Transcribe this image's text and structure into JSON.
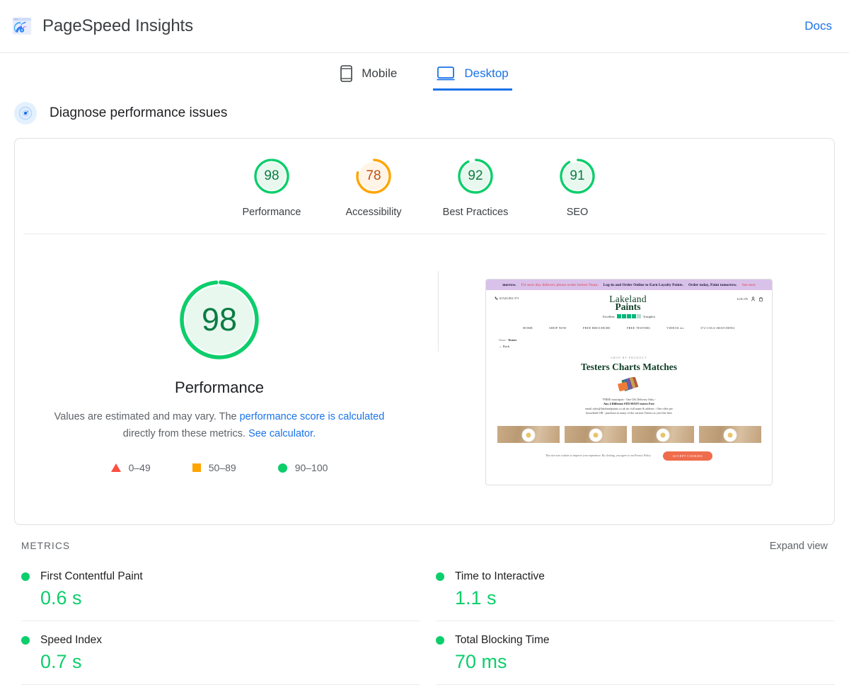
{
  "header": {
    "title": "PageSpeed Insights",
    "logo_icon": "pagespeed-logo",
    "docs_label": "Docs"
  },
  "tabs": [
    {
      "label": "Mobile",
      "icon": "mobile-icon",
      "active": false
    },
    {
      "label": "Desktop",
      "icon": "desktop-icon",
      "active": true
    }
  ],
  "diagnose": {
    "icon": "gauge-icon",
    "title": "Diagnose performance issues"
  },
  "category_scores": [
    {
      "label": "Performance",
      "score": "98",
      "color": "#0cce6b",
      "fill": "#e8f8ef",
      "text_color": "#0a7c43",
      "percent": 98
    },
    {
      "label": "Accessibility",
      "score": "78",
      "color": "#ffa400",
      "fill": "#fff4e5",
      "text_color": "#bf4f12",
      "percent": 78
    },
    {
      "label": "Best Practices",
      "score": "92",
      "color": "#0cce6b",
      "fill": "#e8f8ef",
      "text_color": "#0a7c43",
      "percent": 92
    },
    {
      "label": "SEO",
      "score": "91",
      "color": "#0cce6b",
      "fill": "#e8f8ef",
      "text_color": "#0a7c43",
      "percent": 91
    }
  ],
  "performance_detail": {
    "score": "98",
    "percent": 98,
    "color": "#0cce6b",
    "fill": "#e8f8ef",
    "text_color": "#0a7c43",
    "caption": "Performance",
    "desc_part1": "Values are estimated and may vary. The ",
    "desc_link1": "performance score is calculated",
    "desc_part2": " directly from these metrics. ",
    "desc_link2": "See calculator."
  },
  "legend": [
    {
      "shape": "triangle",
      "range": "0–49",
      "color": "#ff4e42"
    },
    {
      "shape": "square",
      "range": "50–89",
      "color": "#ffa400"
    },
    {
      "shape": "circle",
      "range": "90–100",
      "color": "#0cce6b"
    }
  ],
  "thumbnail": {
    "banner_left": "morrow.",
    "banner_pink1": "Fir next day delivery please order before Noon.",
    "banner_mid": "Log-in and Order Online to Earn Loyalty Points.",
    "banner_right": "Order today, Paint tomorrow.",
    "banner_pink2": "See next",
    "phone": "01524 852 371",
    "brand_line1": "Lakeland",
    "brand_line2": "Paints",
    "login": "LOG IN",
    "trust_label": "Excellent",
    "trust_brand": "Trustpilot",
    "nav": [
      "HOME",
      "SHOP NOW",
      "FREE BROCHURE",
      "FREE TESTERS",
      "VIDEOS etc",
      "372 COLS+MATCHING"
    ],
    "breadcrumb_home": "Home -",
    "breadcrumb_current": "Testers",
    "back": "Back",
    "kicker": "SHOP BY PRODUCT",
    "heading": "Testers Charts Matches",
    "promo_line1": "*FREE matchpots - One UK Delivery Only -",
    "promo_line2": "Any 4 Different STD MATT testers Free",
    "promo_line3": "email sales@lakelandpaints.co.uk inc full name & address - One offer per",
    "promo_line4": "household OR - purchase as many of the various Testers as you like here",
    "cookie_text": "This site uses cookies to improve your experience. By clicking, you agree to our Privacy Policy.",
    "cookie_button": "ACCEPT COOKIES"
  },
  "metrics_section": {
    "title": "METRICS",
    "expand_label": "Expand view"
  },
  "metrics": [
    {
      "name": "First Contentful Paint",
      "value": "0.6 s",
      "status": "pass",
      "color": "#0cce6b"
    },
    {
      "name": "Time to Interactive",
      "value": "1.1 s",
      "status": "pass",
      "color": "#0cce6b"
    },
    {
      "name": "Speed Index",
      "value": "0.7 s",
      "status": "pass",
      "color": "#0cce6b"
    },
    {
      "name": "Total Blocking Time",
      "value": "70 ms",
      "status": "pass",
      "color": "#0cce6b"
    }
  ]
}
